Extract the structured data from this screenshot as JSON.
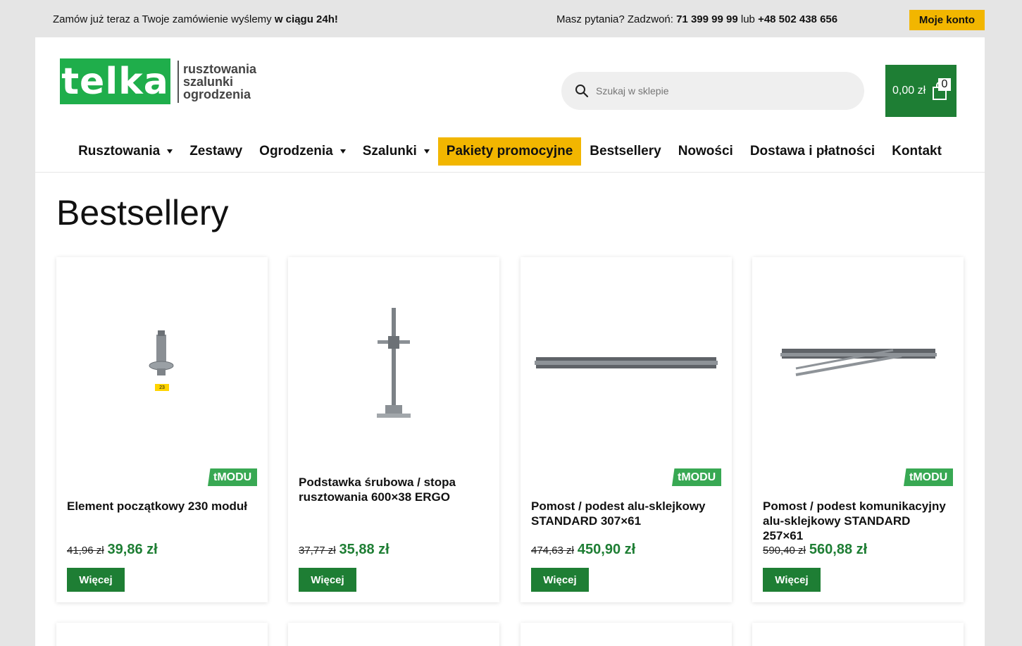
{
  "topbar": {
    "promo_text_start": "Zamów już teraz a Twoje zamówienie wyślemy",
    "promo_text_bold": "w ciągu 24h!",
    "contact_text": "Masz pytania? Zadzwoń:",
    "phone1": "71 399 99 99",
    "or_text": "lub",
    "phone2": "+48 502 438 656",
    "account_label": "Moje konto"
  },
  "logo": {
    "brand": "telka",
    "line1": "rusztowania",
    "line2": "szalunki",
    "line3": "ogrodzenia"
  },
  "search": {
    "placeholder": "Szukaj w sklepie"
  },
  "cart": {
    "total": "0,00 zł",
    "count": "0"
  },
  "nav": {
    "items": [
      {
        "label": "Rusztowania"
      },
      {
        "label": "Zestawy"
      },
      {
        "label": "Ogrodzenia"
      },
      {
        "label": "Szalunki"
      },
      {
        "label": "Pakiety promocyjne"
      },
      {
        "label": "Bestsellery"
      },
      {
        "label": "Nowości"
      },
      {
        "label": "Dostawa i płatności"
      },
      {
        "label": "Kontakt"
      }
    ]
  },
  "main": {
    "title": "Bestsellery"
  },
  "products": [
    {
      "name": "Element początkowy 230 moduł",
      "old_price": "41,96 zł",
      "price": "39,86 zł",
      "button": "Więcej",
      "badge": "tMODU",
      "tag": "23"
    },
    {
      "name": "Podstawka śrubowa / stopa rusztowania 600×38 ERGO",
      "old_price": "37,77 zł",
      "price": "35,88 zł",
      "button": "Więcej"
    },
    {
      "name": "Pomost / podest alu-sklejkowy STANDARD 307×61",
      "old_price": "474,63 zł",
      "price": "450,90 zł",
      "button": "Więcej",
      "badge": "tMODU"
    },
    {
      "name": "Pomost / podest komunikacyjny alu-sklejkowy STANDARD 257×61",
      "old_price": "590,40 zł",
      "price": "560,88 zł",
      "button": "Więcej",
      "badge": "tMODU"
    }
  ],
  "colors": {
    "green": "#1e7e34",
    "brand_green": "#1fae4b",
    "yellow": "#f2b600"
  }
}
